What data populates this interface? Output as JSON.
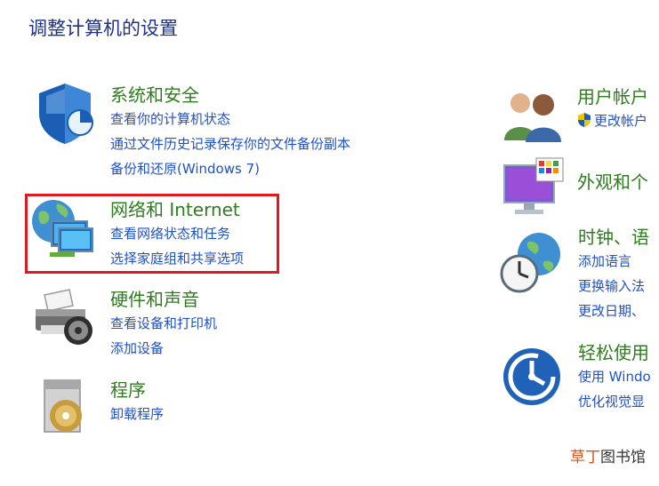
{
  "page": {
    "title": "调整计算机的设置"
  },
  "left_categories": [
    {
      "title": "系统和安全",
      "icon": "shield-icon",
      "links": [
        "查看你的计算机状态",
        "通过文件历史记录保存你的文件备份副本",
        "备份和还原(Windows 7)"
      ]
    },
    {
      "title": "网络和 Internet",
      "icon": "network-icon",
      "links": [
        "查看网络状态和任务",
        "选择家庭组和共享选项"
      ]
    },
    {
      "title": "硬件和声音",
      "icon": "printer-icon",
      "links": [
        "查看设备和打印机",
        "添加设备"
      ]
    },
    {
      "title": "程序",
      "icon": "programs-icon",
      "links": [
        "卸载程序"
      ]
    }
  ],
  "right_categories": [
    {
      "title": "用户帐户",
      "icon": "users-icon",
      "links": [
        "更改帐户"
      ]
    },
    {
      "title": "外观和个",
      "icon": "appearance-icon",
      "links": []
    },
    {
      "title": "时钟、语",
      "icon": "clock-globe-icon",
      "links": [
        "添加语言",
        "更换输入法",
        "更改日期、"
      ]
    },
    {
      "title": "轻松使用",
      "icon": "ease-of-access-icon",
      "links": [
        "使用 Windo",
        "优化视觉显"
      ]
    }
  ],
  "watermark": {
    "part1": "草丁",
    "part2": "图书馆"
  },
  "colors": {
    "title": "#1e3287",
    "category": "#2f7d1e",
    "link": "#1f51c7",
    "highlight": "#e0181f"
  }
}
